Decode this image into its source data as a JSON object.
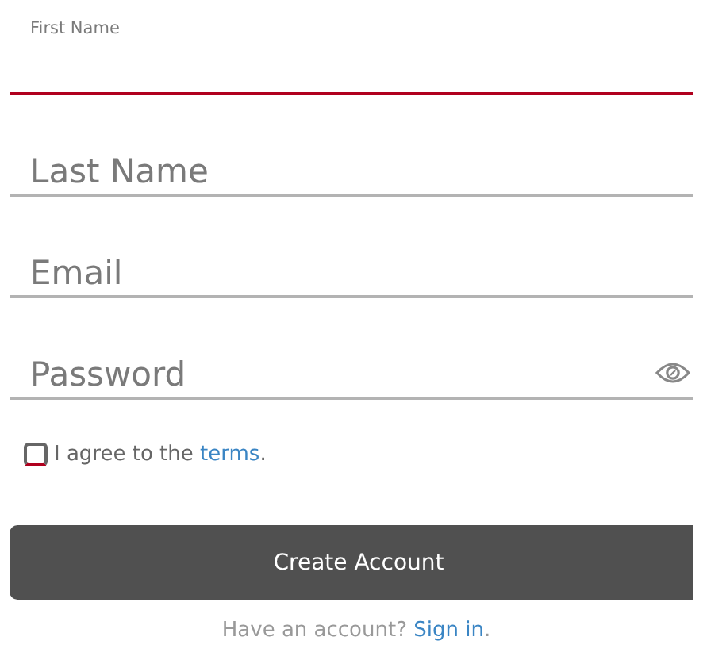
{
  "fields": [
    {
      "label": "First Name",
      "focused": true,
      "reveal_toggle": false
    },
    {
      "label": "Last Name",
      "focused": false,
      "reveal_toggle": false
    },
    {
      "label": "Email",
      "focused": false,
      "reveal_toggle": false
    },
    {
      "label": "Password",
      "focused": false,
      "reveal_toggle": true
    }
  ],
  "terms": {
    "checked": false,
    "text": "I agree to the ",
    "link": "terms",
    "after": "."
  },
  "submit": "Create Account",
  "footer": {
    "text": "Have an account? ",
    "link": "Sign in",
    "after": "."
  }
}
